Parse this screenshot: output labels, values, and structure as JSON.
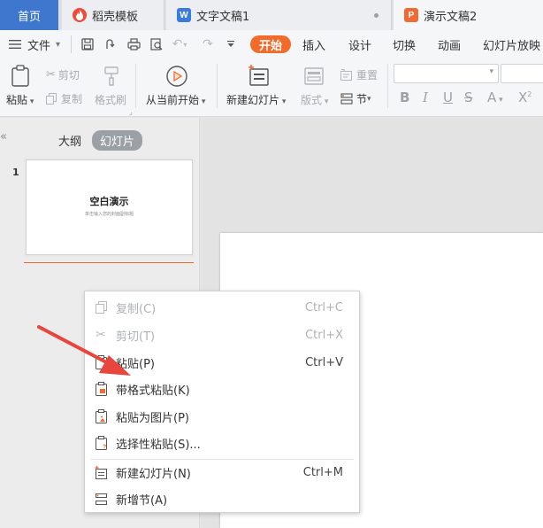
{
  "tabs": [
    {
      "label": "首页",
      "icon": "home"
    },
    {
      "label": "稻壳模板",
      "icon": "daoke-icon"
    },
    {
      "label": "文字文稿1",
      "icon": "word-doc-icon"
    },
    {
      "label": "演示文稿2",
      "icon": "presentation-icon"
    }
  ],
  "menu": {
    "file": "文件",
    "items": [
      "开始",
      "插入",
      "设计",
      "切换",
      "动画",
      "幻灯片放映"
    ]
  },
  "ribbon": {
    "paste": "粘贴",
    "cut": "剪切",
    "copy": "复制",
    "format_painter": "格式刷",
    "play_from_current": "从当前开始",
    "new_slide": "新建幻灯片",
    "layout": "版式",
    "reset": "重置",
    "section": "节"
  },
  "panel": {
    "outline_tab": "大纲",
    "slides_tab": "幻灯片",
    "slide_number": "1",
    "thumb_title": "空白演示",
    "thumb_subtitle": "单击输入您的封面副标题"
  },
  "context_menu": [
    {
      "label": "复制(C)",
      "shortcut": "Ctrl+C",
      "icon": "copy-icon",
      "disabled": true
    },
    {
      "label": "剪切(T)",
      "shortcut": "Ctrl+X",
      "icon": "scissors-icon",
      "disabled": true
    },
    {
      "label": "粘贴(P)",
      "shortcut": "Ctrl+V",
      "icon": "paste-icon",
      "disabled": false
    },
    {
      "label": "带格式粘贴(K)",
      "shortcut": "",
      "icon": "paste-format-icon",
      "disabled": false
    },
    {
      "label": "粘贴为图片(P)",
      "shortcut": "",
      "icon": "paste-image-icon",
      "disabled": false
    },
    {
      "label": "选择性粘贴(S)...",
      "shortcut": "",
      "icon": "paste-special-icon",
      "disabled": false
    },
    {
      "label": "新建幻灯片(N)",
      "shortcut": "Ctrl+M",
      "icon": "new-slide-icon",
      "disabled": false
    },
    {
      "label": "新增节(A)",
      "shortcut": "",
      "icon": "new-section-icon",
      "disabled": false
    }
  ],
  "colors": {
    "accent": "#f36b2b",
    "home_tab": "#3f77cf",
    "arrow": "#e8453c"
  }
}
